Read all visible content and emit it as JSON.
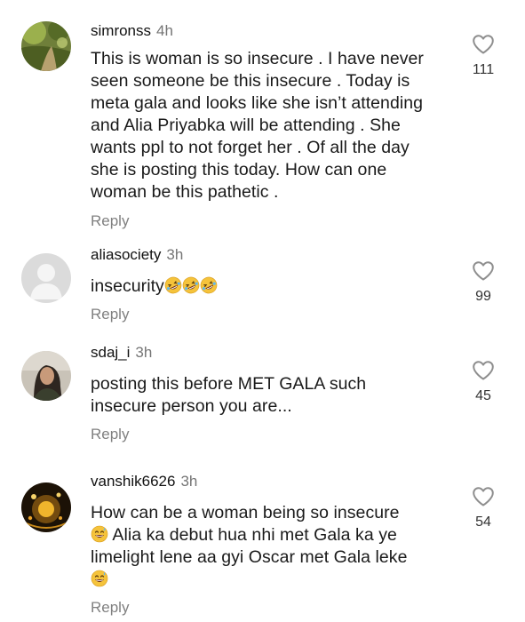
{
  "comments": [
    {
      "username": "simronss",
      "time": "4h",
      "text_lines": [
        "This is woman is so insecure . I have never",
        "seen someone be this insecure . Today is",
        "meta gala and looks like she isn’t attending",
        "and Alia Priyabka will be attending . She",
        "wants ppl to not forget her . Of all the day",
        "she is posting this today. How can one",
        "woman be this pathetic ."
      ],
      "reply_label": "Reply",
      "like_count": "111",
      "avatar": "nature-photo-avatar"
    },
    {
      "username": "aliasociety",
      "time": "3h",
      "text_lines": [
        "insecurity"
      ],
      "emojis": [
        "rolling-on-floor-laughing",
        "rolling-on-floor-laughing",
        "rolling-on-floor-laughing"
      ],
      "reply_label": "Reply",
      "like_count": "99",
      "avatar": "default-profile-avatar"
    },
    {
      "username": "sdaj_i",
      "time": "3h",
      "text_lines": [
        "posting this before MET GALA such",
        "insecure person you are..."
      ],
      "reply_label": "Reply",
      "like_count": "45",
      "avatar": "woman-photo-avatar"
    },
    {
      "username": "vanshik6626",
      "time": "3h",
      "text_lines": [
        "How can be a  woman being so insecure",
        "Alia ka debut hua nhi met Gala ka ye",
        "limelight lene aa gyi Oscar met Gala leke"
      ],
      "emojis_inline": [
        "grinning-sweat",
        "grinning-sweat"
      ],
      "reply_label": "Reply",
      "like_count": "54",
      "avatar": "golden-sparkle-avatar"
    }
  ],
  "colors": {
    "text": "#1a1a1a",
    "meta": "#757575",
    "reply": "#808080",
    "heart_outline": "#8e8e8e",
    "emoji_yellow": "#f5c33b"
  }
}
